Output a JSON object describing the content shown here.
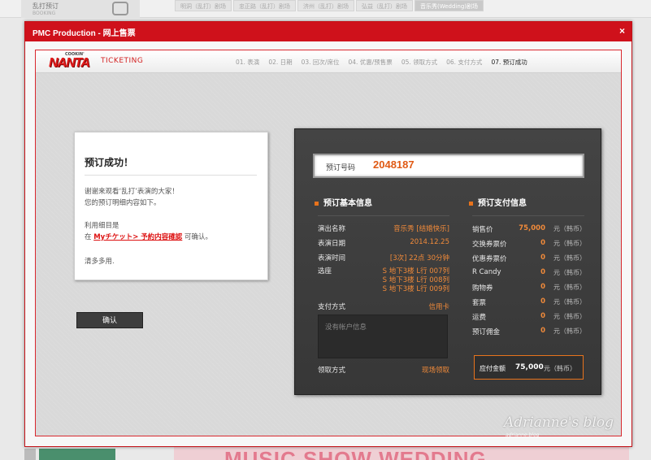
{
  "background": {
    "left_title": "乱打预订",
    "left_sub": "BOOKING",
    "tabs": [
      "明洞（乱打）剧场",
      "忠正路（乱打）剧场",
      "济州（乱打）剧场",
      "弘益（乱打）剧场",
      "音乐秀(Wedding)剧场"
    ],
    "banner_text": "MUSIC SHOW WEDDING"
  },
  "modal": {
    "title": "PMC Production - 网上售票",
    "close": "×"
  },
  "header": {
    "logo_top": "COOKIN'",
    "logo": "NANTA",
    "ticketing": "TICKETING",
    "steps": [
      "01. 表演",
      "02. 日期",
      "03. 回次/席位",
      "04. 优惠/预售票",
      "05. 领取方式",
      "06. 支付方式",
      "07. 预订成功"
    ]
  },
  "card": {
    "title": "预订成功！",
    "line1": "谢谢来观看‘乱打’表演的大家！",
    "line2": "您的预订明细内容如下。",
    "line3": "利用细目是",
    "line4_pre": "在",
    "line4_link": "Myチケット> 予約内容確認",
    "line4_post": "可确认。",
    "line5": "清多多用.",
    "confirm": "确认"
  },
  "panel": {
    "res_label": "预订号码",
    "res_number": "2048187",
    "info_head": "预订基本信息",
    "pay_head": "预订支付信息",
    "info": {
      "show_label": "演出名称",
      "show_value": "音乐秀 [结婚快乐]",
      "date_label": "表演日期",
      "date_value": "2014.12.25",
      "time_label": "表演时间",
      "time_value": "[3次] 22点 30分钟",
      "seat_label": "选座",
      "seats": [
        "S 地下3楼 L行 007列",
        "S 地下3楼 L行 008列",
        "S 地下3楼 L行 009列"
      ],
      "paymethod_label": "支付方式",
      "paymethod_value": "信用卡",
      "acct_placeholder": "没有帐户信息",
      "pickup_label": "领取方式",
      "pickup_value": "现场领取"
    },
    "pay": [
      {
        "label": "销售价",
        "amount": "75,000",
        "unit": "元（韩币）"
      },
      {
        "label": "交换券票价",
        "amount": "0",
        "unit": "元（韩币）"
      },
      {
        "label": "优惠券票价",
        "amount": "0",
        "unit": "元（韩币）"
      },
      {
        "label": "R Candy",
        "amount": "0",
        "unit": "元（韩币）"
      },
      {
        "label": "购物券",
        "amount": "0",
        "unit": "元（韩币）"
      },
      {
        "label": "套票",
        "amount": "0",
        "unit": "元（韩币）"
      },
      {
        "label": "运费",
        "amount": "0",
        "unit": "元（韩币）"
      },
      {
        "label": "预订佣金",
        "amount": "0",
        "unit": "元（韩币）"
      }
    ],
    "total_label": "应付金额",
    "total_amount": "75,000",
    "total_unit": "元（韩币）"
  },
  "watermark": {
    "text": "Adrianne's blog",
    "sub": "adrianne.blog"
  }
}
